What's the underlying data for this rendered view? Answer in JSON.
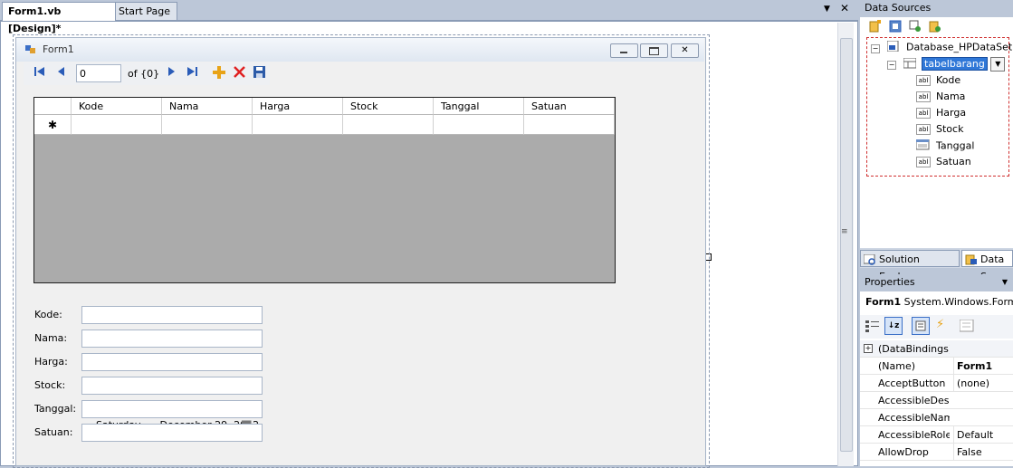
{
  "document_tabs": {
    "active": "Form1.vb [Design]*",
    "other": "Start Page",
    "dropdown_glyph": "▼",
    "close_glyph": "✕"
  },
  "form": {
    "title": "Form1",
    "navigator": {
      "position": "0",
      "count": "of {0}"
    },
    "grid": {
      "columns": [
        "Kode",
        "Nama",
        "Harga",
        "Stock",
        "Tanggal",
        "Satuan"
      ],
      "new_row_glyph": "✱"
    },
    "fields": [
      {
        "label": "Kode:",
        "value": ""
      },
      {
        "label": "Nama:",
        "value": ""
      },
      {
        "label": "Harga:",
        "value": ""
      },
      {
        "label": "Stock:",
        "value": ""
      },
      {
        "label": "Tanggal:",
        "value": "Saturday    , December 29, 2012"
      },
      {
        "label": "Satuan:",
        "value": ""
      }
    ]
  },
  "data_sources": {
    "title": "Data Sources",
    "dataset": "Database_HPDataSet",
    "table": "tabelbarang",
    "columns": [
      "Kode",
      "Nama",
      "Harga",
      "Stock",
      "Tanggal",
      "Satuan"
    ]
  },
  "bottom_tabs": [
    "Solution Explo...",
    "Data So"
  ],
  "properties": {
    "title": "Properties",
    "object": "Form1",
    "object_type": "System.Windows.Form",
    "rows": [
      {
        "name": "(DataBindings)",
        "value": ""
      },
      {
        "name": "(Name)",
        "value": "Form1"
      },
      {
        "name": "AcceptButton",
        "value": "(none)"
      },
      {
        "name": "AccessibleDesc",
        "value": ""
      },
      {
        "name": "AccessibleNam",
        "value": ""
      },
      {
        "name": "AccessibleRole",
        "value": "Default"
      },
      {
        "name": "AllowDrop",
        "value": "False"
      }
    ]
  }
}
